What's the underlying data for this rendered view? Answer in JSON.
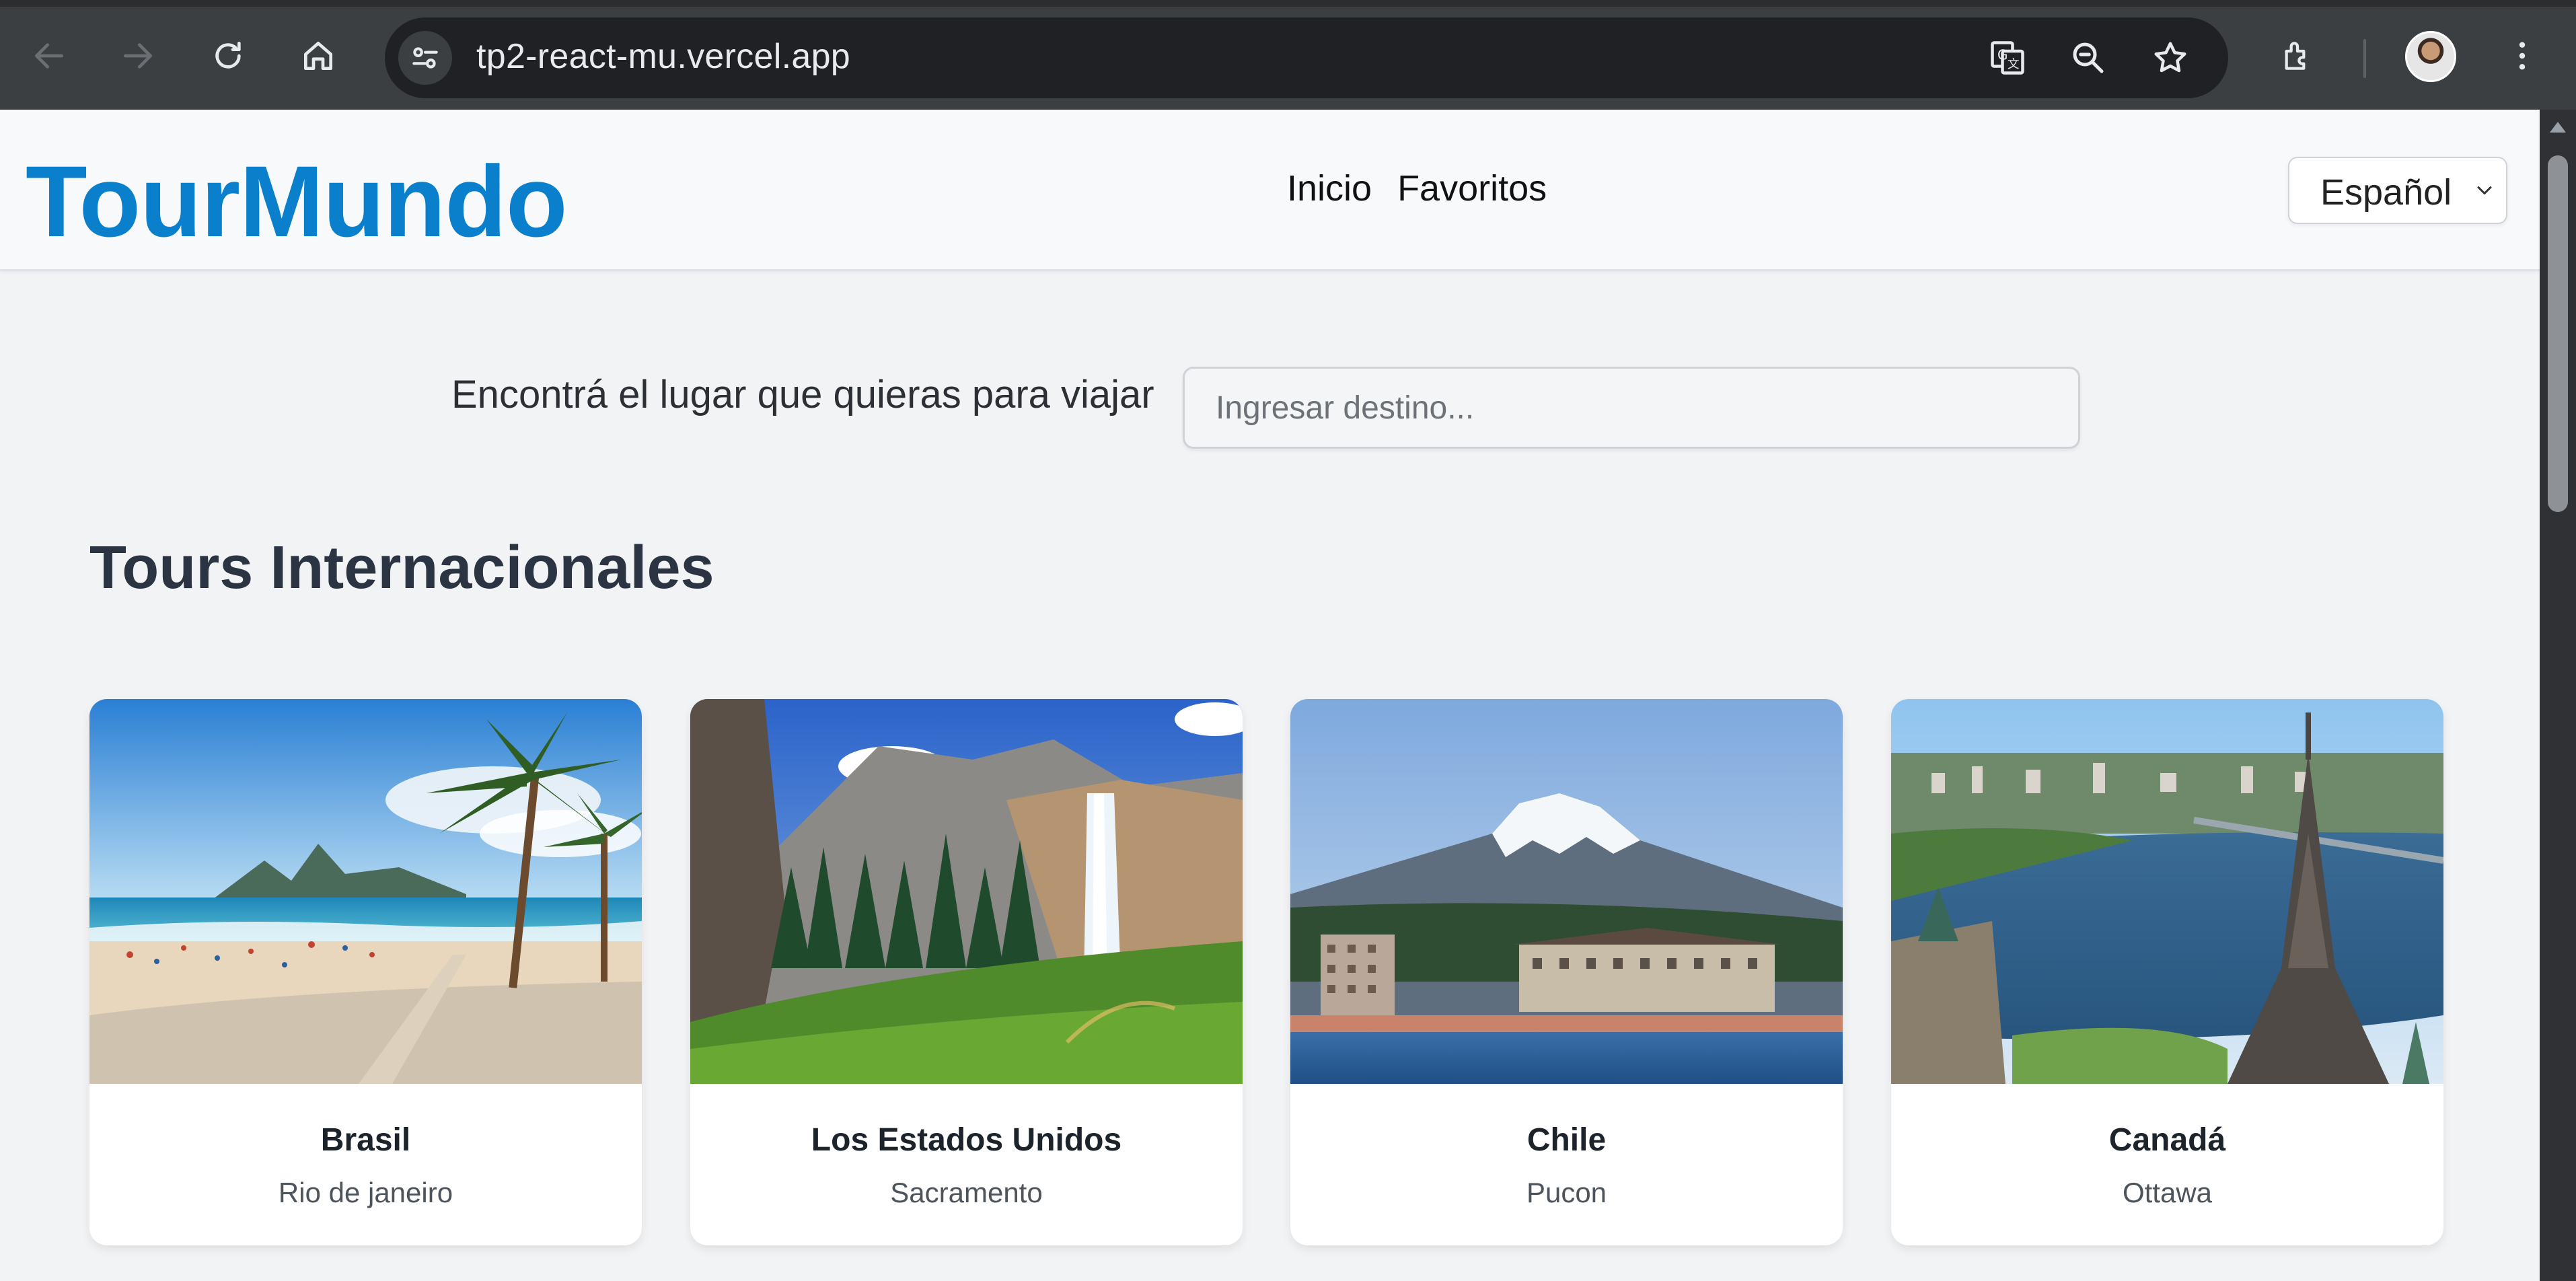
{
  "browser": {
    "url": "tp2-react-mu.vercel.app",
    "icons": [
      "back-icon",
      "forward-icon",
      "reload-icon",
      "home-icon",
      "site-info-icon",
      "translate-icon",
      "zoom-icon",
      "bookmark-star-icon",
      "extensions-icon",
      "profile-avatar",
      "more-menu-icon"
    ]
  },
  "header": {
    "logo": "TourMundo",
    "nav": [
      {
        "label": "Inicio"
      },
      {
        "label": "Favoritos"
      }
    ],
    "language": {
      "selected": "Español"
    }
  },
  "search": {
    "label": "Encontrá el lugar que quieras para viajar",
    "placeholder": "Ingresar destino..."
  },
  "section": {
    "title": "Tours Internacionales"
  },
  "cards": [
    {
      "country": "Brasil",
      "city": "Rio de janeiro"
    },
    {
      "country": "Los Estados Unidos",
      "city": "Sacramento"
    },
    {
      "country": "Chile",
      "city": "Pucon"
    },
    {
      "country": "Canadá",
      "city": "Ottawa"
    }
  ],
  "colors": {
    "logo": "#0a7fcb",
    "page_bg": "#f2f3f5",
    "chrome_bg": "#3c3f41"
  }
}
